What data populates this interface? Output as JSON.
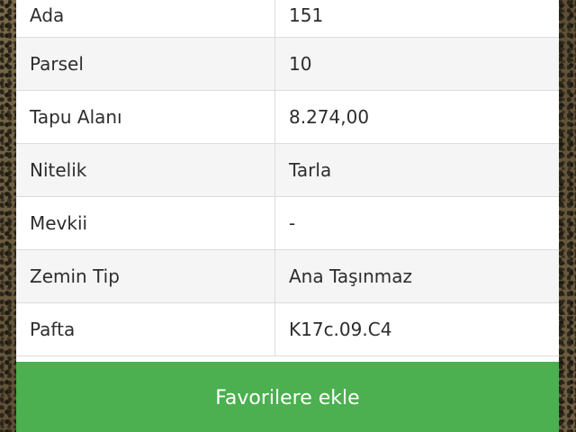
{
  "parcel_info": {
    "rows": [
      {
        "label": "Ada",
        "value": "151"
      },
      {
        "label": "Parsel",
        "value": "10"
      },
      {
        "label": "Tapu Alanı",
        "value": "8.274,00"
      },
      {
        "label": "Nitelik",
        "value": "Tarla"
      },
      {
        "label": "Mevkii",
        "value": "-"
      },
      {
        "label": "Zemin Tip",
        "value": "Ana Taşınmaz"
      },
      {
        "label": "Pafta",
        "value": "K17c.09.C4"
      }
    ]
  },
  "actions": {
    "add_favorite_label": "Favorilere ekle",
    "button_color": "#4caf50"
  },
  "colors": {
    "row_alt": "#f5f5f5",
    "border": "#dcdcdc",
    "text": "#2d2d2d"
  }
}
